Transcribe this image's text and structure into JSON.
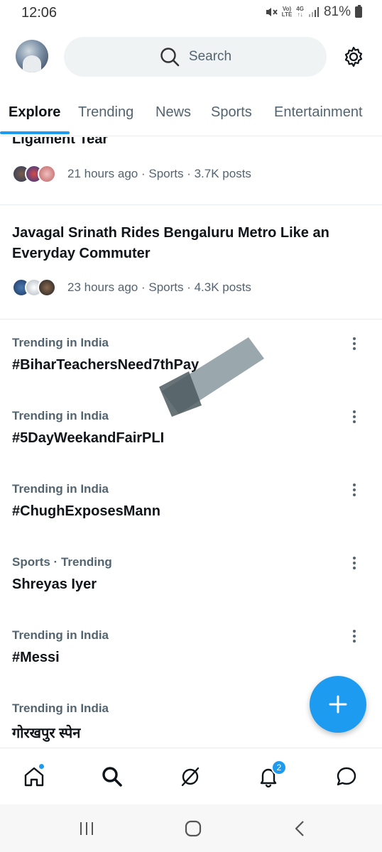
{
  "status_bar": {
    "time": "12:06",
    "network_top": "Vo)",
    "network_bottom": "LTE",
    "data_top": "4G",
    "data_bottom": "↑↓",
    "battery": "81%"
  },
  "header": {
    "search_placeholder": "Search"
  },
  "tabs": [
    {
      "label": "Explore",
      "active": true
    },
    {
      "label": "Trending",
      "active": false
    },
    {
      "label": "News",
      "active": false
    },
    {
      "label": "Sports",
      "active": false
    },
    {
      "label": "Entertainment",
      "active": false
    }
  ],
  "news": [
    {
      "title": "Ligament Tear",
      "meta": "21 hours ago · Sports · 3.7K posts"
    },
    {
      "title": "Javagal Srinath Rides Bengaluru Metro Like an Everyday Commuter",
      "meta": "23 hours ago · Sports · 4.3K posts"
    }
  ],
  "trends": [
    {
      "context": "Trending in India",
      "name": "#BiharTeachersNeed7thPay"
    },
    {
      "context": "Trending in India",
      "name": "#5DayWeekandFairPLI"
    },
    {
      "context": "Trending in India",
      "name": "#ChughExposesMann"
    },
    {
      "context": "Sports · Trending",
      "name": "Shreyas Iyer"
    },
    {
      "context": "Trending in India",
      "name": "#Messi"
    },
    {
      "context": "Trending in India",
      "name": "गोरखपुर स्पेन"
    }
  ],
  "bottom_nav": {
    "notifications_count": "2"
  },
  "colors": {
    "accent": "#1d9bf0",
    "text_primary": "#0f1419",
    "text_secondary": "#536471",
    "divider": "#e6ecf0"
  },
  "icons": {
    "header": [
      "avatar",
      "search-icon",
      "gear-icon"
    ],
    "nav": [
      "home-icon",
      "search-icon",
      "grok-icon",
      "bell-icon",
      "messages-icon"
    ],
    "fab": "plus-icon",
    "system": [
      "recents-icon",
      "home-circle-icon",
      "back-icon"
    ]
  }
}
